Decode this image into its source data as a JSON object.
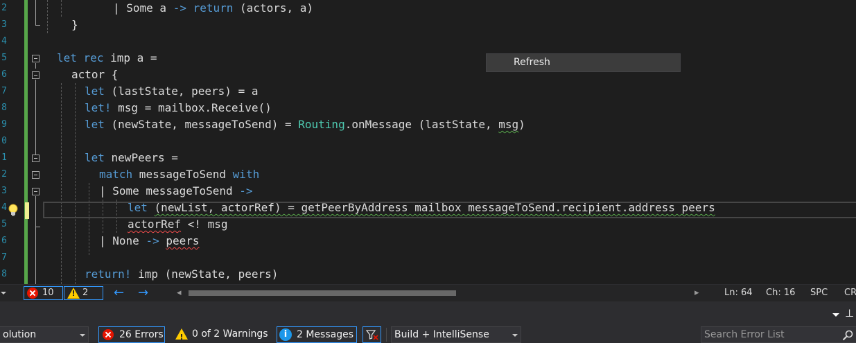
{
  "editor": {
    "line_numbers": [
      "2",
      "3",
      "4",
      "5",
      "6",
      "7",
      "8",
      "9",
      "0",
      "1",
      "2",
      "3",
      "4",
      "5",
      "6",
      "7",
      "8"
    ],
    "lines": [
      [
        [
          "pl",
          "| Some a "
        ],
        [
          "kw",
          "->"
        ],
        [
          "pl",
          " "
        ],
        [
          "kw",
          "return"
        ],
        [
          "pl",
          " (actors, a)"
        ]
      ],
      [
        [
          "pl",
          "}"
        ]
      ],
      [],
      [
        [
          "kw",
          "let"
        ],
        [
          "pl",
          " "
        ],
        [
          "kw",
          "rec"
        ],
        [
          "pl",
          " imp a ="
        ]
      ],
      [
        [
          "pl",
          "actor {"
        ]
      ],
      [
        [
          "kw",
          "let"
        ],
        [
          "pl",
          " (lastState, peers) = a"
        ]
      ],
      [
        [
          "kw",
          "let!"
        ],
        [
          "pl",
          " msg = mailbox.Receive()"
        ]
      ],
      [
        [
          "kw",
          "let"
        ],
        [
          "pl",
          " (newState, messageToSend) = "
        ],
        [
          "ty",
          "Routing"
        ],
        [
          "pl",
          ".onMessage (lastState, "
        ],
        [
          "pl sq sq-ok",
          "msg"
        ],
        [
          "pl",
          ")"
        ]
      ],
      [],
      [
        [
          "kw",
          "let"
        ],
        [
          "pl",
          " newPeers ="
        ]
      ],
      [
        [
          "kw",
          "match"
        ],
        [
          "pl",
          " messageToSend "
        ],
        [
          "kw",
          "with"
        ]
      ],
      [
        [
          "pl",
          "| Some messageToSend "
        ],
        [
          "kw",
          "->"
        ]
      ],
      [
        [
          "kw",
          "let"
        ],
        [
          "pl",
          " "
        ],
        [
          "pl sq sq-ok",
          "(newList, actorRef) = getPeerByAddress mailbox messageToSend.recipient.address peers"
        ]
      ],
      [
        [
          "pl sq sq-err",
          "actorRef"
        ],
        [
          "pl",
          " <! msg"
        ]
      ],
      [
        [
          "pl",
          "| None "
        ],
        [
          "kw",
          "->"
        ],
        [
          "pl",
          " "
        ],
        [
          "pl sq sq-err",
          "peers"
        ]
      ],
      [],
      [
        [
          "kw",
          "return!"
        ],
        [
          "pl",
          " imp (newState, peers)"
        ]
      ]
    ],
    "context_menu": {
      "refresh_label": "Refresh"
    }
  },
  "editor_status": {
    "error_count": "10",
    "warning_count": "2",
    "nav_back": "←",
    "nav_forward": "→",
    "scroll_left": "◂",
    "scroll_right": "▸",
    "ln": "Ln: 64",
    "ch": "Ch: 16",
    "spc": "SPC",
    "crlf": "CR"
  },
  "error_list": {
    "pin": "⊥",
    "scope_value": "olution",
    "errors_label": "26 Errors",
    "warnings_label": "0 of 2 Warnings",
    "messages_label": "2 Messages",
    "build_filter": "Build + IntelliSense",
    "search_placeholder": "Search Error List"
  },
  "colors": {
    "keyword": "#569cd6",
    "type": "#4ec9b0",
    "error": "#e51400",
    "warning": "#ffcc00",
    "change_saved": "#57a64a",
    "change_unsaved": "#efef91"
  }
}
